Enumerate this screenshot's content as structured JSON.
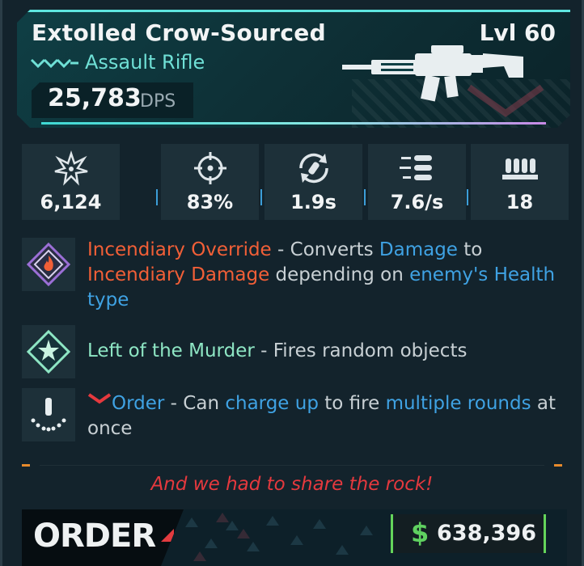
{
  "weapon": {
    "name": "Extolled Crow-Sourced",
    "level": "Lvl 60",
    "type": "Assault Rifle",
    "dps_value": "25,783",
    "dps_unit": "DPS",
    "rarity_color": "#6fe0d6"
  },
  "stats": [
    {
      "icon": "damage-burst-icon",
      "value": "6,124"
    },
    {
      "icon": "accuracy-crosshair-icon",
      "value": "83%"
    },
    {
      "icon": "reload-icon",
      "value": "1.9s"
    },
    {
      "icon": "fire-rate-icon",
      "value": "7.6/s"
    },
    {
      "icon": "magazine-icon",
      "value": "18"
    }
  ],
  "perks": [
    {
      "icon": "incendiary-element-icon",
      "parts": [
        "Incendiary Override",
        " - Converts ",
        "Damage",
        " to ",
        "Incendiary Damage",
        " depending on ",
        "enemy's Health type"
      ]
    },
    {
      "icon": "gun-perk-star-icon",
      "parts": [
        "Left of the Murder",
        " - Fires random objects"
      ]
    },
    {
      "icon": "order-ammo-icon",
      "parts": [
        "Order",
        " - Can ",
        "charge up",
        " to fire ",
        "multiple rounds",
        " at once"
      ]
    }
  ],
  "flavor_text": "And we had to share the rock!",
  "manufacturer": "ORDER",
  "price": {
    "currency_symbol": "$",
    "value": "638,396"
  },
  "colors": {
    "element_orange": "#f25f37",
    "keyword_blue": "#3fa2e3",
    "perk_mint": "#8ee6c4",
    "flavor_red": "#e5393e",
    "price_green": "#5fd160"
  }
}
